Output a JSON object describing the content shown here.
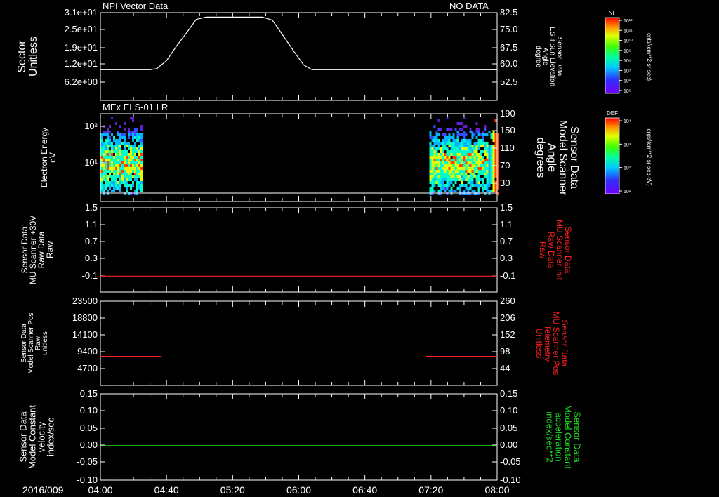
{
  "header": {
    "panel1_title": "NPI Vector Data",
    "panel1_status": "NO DATA",
    "panel2_title": "MEx ELS-01 LR"
  },
  "time_axis": {
    "date_label": "2016/009",
    "tick_labels": [
      "04:00",
      "04:40",
      "05:20",
      "06:00",
      "06:40",
      "07:20",
      "08:00"
    ]
  },
  "colorbars": [
    {
      "title": "NF",
      "unit": "cnts/(cm**2-sr-sec)",
      "tick_labels": [
        "10¹²",
        "10¹¹",
        "10¹⁰",
        "10⁹",
        "10⁸",
        "10⁷",
        "10⁶",
        "10⁵"
      ]
    },
    {
      "title": "DEF",
      "unit": "ergs/(cm**2-sr-sec-eV)",
      "tick_labels": [
        "10⁴",
        "10³",
        "10²",
        "10¹"
      ]
    }
  ],
  "chart_data": [
    {
      "type": "line",
      "left_label": [
        "Sector",
        "Unitless"
      ],
      "left_ticks": [
        "3.1e+01",
        "2.5e+01",
        "1.9e+01",
        "1.2e+01",
        "6.2e+00"
      ],
      "right_label": [
        "Sensor Data",
        "ESH Sun Elevation",
        "Angle",
        "degree"
      ],
      "right_ticks": [
        "82.5",
        "75.0",
        "67.5",
        "60.0",
        "52.5"
      ],
      "ylim": [
        47.3,
        82.5
      ],
      "series": [
        {
          "color": "#ffffff",
          "x": [
            "04:00",
            "04:30",
            "04:34",
            "04:40",
            "04:46",
            "04:53",
            "04:58",
            "05:04",
            "05:38",
            "05:44",
            "05:50",
            "05:57",
            "06:03",
            "06:08",
            "08:00"
          ],
          "y": [
            59.6,
            59.6,
            60.0,
            63.2,
            69.0,
            75.2,
            79.8,
            80.7,
            80.7,
            79.5,
            73.8,
            67.0,
            61.5,
            59.6,
            59.6
          ]
        }
      ]
    },
    {
      "type": "heatmap",
      "left_label": [
        "Electron Energy",
        "eV"
      ],
      "left_ticks": [
        "10²",
        "10¹"
      ],
      "right_label": [
        "Sensor Data",
        "Model Scanner",
        "Angle",
        "degrees"
      ],
      "right_ticks": [
        "190",
        "150",
        "110",
        "70",
        "30"
      ],
      "ylim_energy": [
        1.25,
        150
      ],
      "data_intervals": [
        [
          "04:00",
          "04:25"
        ],
        [
          "07:19",
          "08:00"
        ]
      ],
      "colormap": "rainbow (purple low → red high)"
    },
    {
      "type": "line",
      "left_label": [
        "Sensor Data",
        "MU Scanner +30V",
        "Raw Data",
        "Raw"
      ],
      "left_ticks": [
        "1.5",
        "1.1",
        "0.7",
        "0.3",
        "-0.1"
      ],
      "right_label": [
        "Sensor Data",
        "MU Scanner Init",
        "Raw Data",
        "Raw"
      ],
      "right_ticks": [
        "1.5",
        "1.1",
        "0.7",
        "0.3",
        "-0.1"
      ],
      "right_color": "#ff2020",
      "ylim": [
        -0.35,
        1.5
      ],
      "series": [
        {
          "color": "#ff2020",
          "x": [
            "04:00",
            "08:00"
          ],
          "y": [
            0.0,
            0.0
          ]
        }
      ]
    },
    {
      "type": "line",
      "left_label": [
        "Sensor Data",
        "Model Scanner Pos",
        "Raw",
        "unitless"
      ],
      "left_ticks": [
        "23500",
        "18800",
        "14100",
        "9400",
        "4700"
      ],
      "right_label": [
        "Sensor Data",
        "MU Scanner Pos",
        "Telemetry",
        "Unitless"
      ],
      "right_ticks": [
        "260",
        "206",
        "152",
        "98",
        "44"
      ],
      "right_color": "#ff2020",
      "ylim": [
        0,
        23500
      ],
      "series": [
        {
          "color": "#ff2020",
          "x": [
            "04:00",
            "04:37"
          ],
          "y": [
            8100,
            8100
          ]
        },
        {
          "color": "#ff2020",
          "x": [
            "07:17",
            "08:00"
          ],
          "y": [
            8100,
            8100
          ]
        }
      ]
    },
    {
      "type": "line",
      "left_label": [
        "Sensor Data",
        "Model Constant",
        "velocity",
        "index/sec"
      ],
      "left_ticks": [
        "0.15",
        "0.10",
        "0.05",
        "0.00",
        "-0.05",
        "-0.10"
      ],
      "right_label": [
        "Sensor Data",
        "Model Constant",
        "acceleration",
        "index/sec**2"
      ],
      "right_ticks": [
        "0.15",
        "0.10",
        "0.05",
        "0.00",
        "-0.05",
        "-0.10"
      ],
      "right_color": "#20e020",
      "ylim": [
        -0.1,
        0.15
      ],
      "series": [
        {
          "color": "#20e020",
          "x": [
            "04:00",
            "08:00"
          ],
          "y": [
            0.0,
            0.0
          ]
        }
      ]
    }
  ]
}
